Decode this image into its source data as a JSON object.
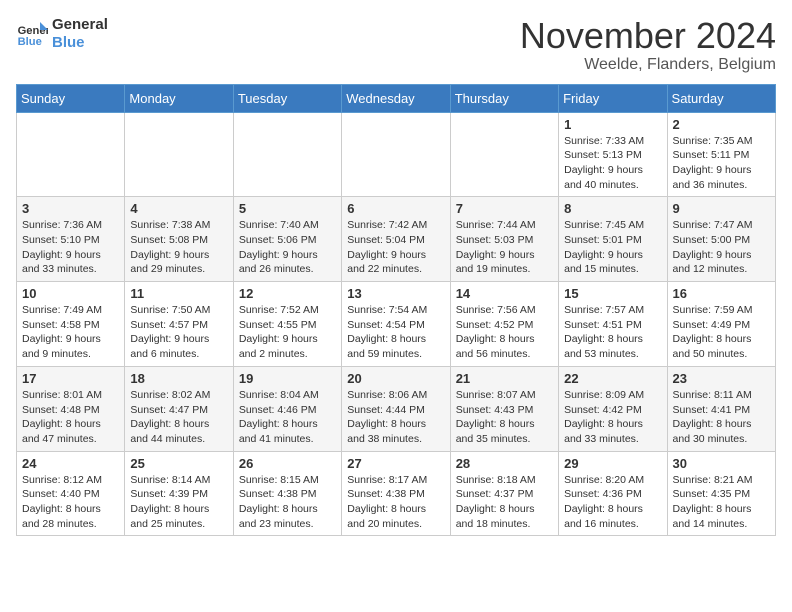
{
  "logo": {
    "text_general": "General",
    "text_blue": "Blue"
  },
  "header": {
    "month": "November 2024",
    "location": "Weelde, Flanders, Belgium"
  },
  "weekdays": [
    "Sunday",
    "Monday",
    "Tuesday",
    "Wednesday",
    "Thursday",
    "Friday",
    "Saturday"
  ],
  "weeks": [
    [
      {
        "day": "",
        "info": ""
      },
      {
        "day": "",
        "info": ""
      },
      {
        "day": "",
        "info": ""
      },
      {
        "day": "",
        "info": ""
      },
      {
        "day": "",
        "info": ""
      },
      {
        "day": "1",
        "info": "Sunrise: 7:33 AM\nSunset: 5:13 PM\nDaylight: 9 hours\nand 40 minutes."
      },
      {
        "day": "2",
        "info": "Sunrise: 7:35 AM\nSunset: 5:11 PM\nDaylight: 9 hours\nand 36 minutes."
      }
    ],
    [
      {
        "day": "3",
        "info": "Sunrise: 7:36 AM\nSunset: 5:10 PM\nDaylight: 9 hours\nand 33 minutes."
      },
      {
        "day": "4",
        "info": "Sunrise: 7:38 AM\nSunset: 5:08 PM\nDaylight: 9 hours\nand 29 minutes."
      },
      {
        "day": "5",
        "info": "Sunrise: 7:40 AM\nSunset: 5:06 PM\nDaylight: 9 hours\nand 26 minutes."
      },
      {
        "day": "6",
        "info": "Sunrise: 7:42 AM\nSunset: 5:04 PM\nDaylight: 9 hours\nand 22 minutes."
      },
      {
        "day": "7",
        "info": "Sunrise: 7:44 AM\nSunset: 5:03 PM\nDaylight: 9 hours\nand 19 minutes."
      },
      {
        "day": "8",
        "info": "Sunrise: 7:45 AM\nSunset: 5:01 PM\nDaylight: 9 hours\nand 15 minutes."
      },
      {
        "day": "9",
        "info": "Sunrise: 7:47 AM\nSunset: 5:00 PM\nDaylight: 9 hours\nand 12 minutes."
      }
    ],
    [
      {
        "day": "10",
        "info": "Sunrise: 7:49 AM\nSunset: 4:58 PM\nDaylight: 9 hours\nand 9 minutes."
      },
      {
        "day": "11",
        "info": "Sunrise: 7:50 AM\nSunset: 4:57 PM\nDaylight: 9 hours\nand 6 minutes."
      },
      {
        "day": "12",
        "info": "Sunrise: 7:52 AM\nSunset: 4:55 PM\nDaylight: 9 hours\nand 2 minutes."
      },
      {
        "day": "13",
        "info": "Sunrise: 7:54 AM\nSunset: 4:54 PM\nDaylight: 8 hours\nand 59 minutes."
      },
      {
        "day": "14",
        "info": "Sunrise: 7:56 AM\nSunset: 4:52 PM\nDaylight: 8 hours\nand 56 minutes."
      },
      {
        "day": "15",
        "info": "Sunrise: 7:57 AM\nSunset: 4:51 PM\nDaylight: 8 hours\nand 53 minutes."
      },
      {
        "day": "16",
        "info": "Sunrise: 7:59 AM\nSunset: 4:49 PM\nDaylight: 8 hours\nand 50 minutes."
      }
    ],
    [
      {
        "day": "17",
        "info": "Sunrise: 8:01 AM\nSunset: 4:48 PM\nDaylight: 8 hours\nand 47 minutes."
      },
      {
        "day": "18",
        "info": "Sunrise: 8:02 AM\nSunset: 4:47 PM\nDaylight: 8 hours\nand 44 minutes."
      },
      {
        "day": "19",
        "info": "Sunrise: 8:04 AM\nSunset: 4:46 PM\nDaylight: 8 hours\nand 41 minutes."
      },
      {
        "day": "20",
        "info": "Sunrise: 8:06 AM\nSunset: 4:44 PM\nDaylight: 8 hours\nand 38 minutes."
      },
      {
        "day": "21",
        "info": "Sunrise: 8:07 AM\nSunset: 4:43 PM\nDaylight: 8 hours\nand 35 minutes."
      },
      {
        "day": "22",
        "info": "Sunrise: 8:09 AM\nSunset: 4:42 PM\nDaylight: 8 hours\nand 33 minutes."
      },
      {
        "day": "23",
        "info": "Sunrise: 8:11 AM\nSunset: 4:41 PM\nDaylight: 8 hours\nand 30 minutes."
      }
    ],
    [
      {
        "day": "24",
        "info": "Sunrise: 8:12 AM\nSunset: 4:40 PM\nDaylight: 8 hours\nand 28 minutes."
      },
      {
        "day": "25",
        "info": "Sunrise: 8:14 AM\nSunset: 4:39 PM\nDaylight: 8 hours\nand 25 minutes."
      },
      {
        "day": "26",
        "info": "Sunrise: 8:15 AM\nSunset: 4:38 PM\nDaylight: 8 hours\nand 23 minutes."
      },
      {
        "day": "27",
        "info": "Sunrise: 8:17 AM\nSunset: 4:38 PM\nDaylight: 8 hours\nand 20 minutes."
      },
      {
        "day": "28",
        "info": "Sunrise: 8:18 AM\nSunset: 4:37 PM\nDaylight: 8 hours\nand 18 minutes."
      },
      {
        "day": "29",
        "info": "Sunrise: 8:20 AM\nSunset: 4:36 PM\nDaylight: 8 hours\nand 16 minutes."
      },
      {
        "day": "30",
        "info": "Sunrise: 8:21 AM\nSunset: 4:35 PM\nDaylight: 8 hours\nand 14 minutes."
      }
    ]
  ]
}
